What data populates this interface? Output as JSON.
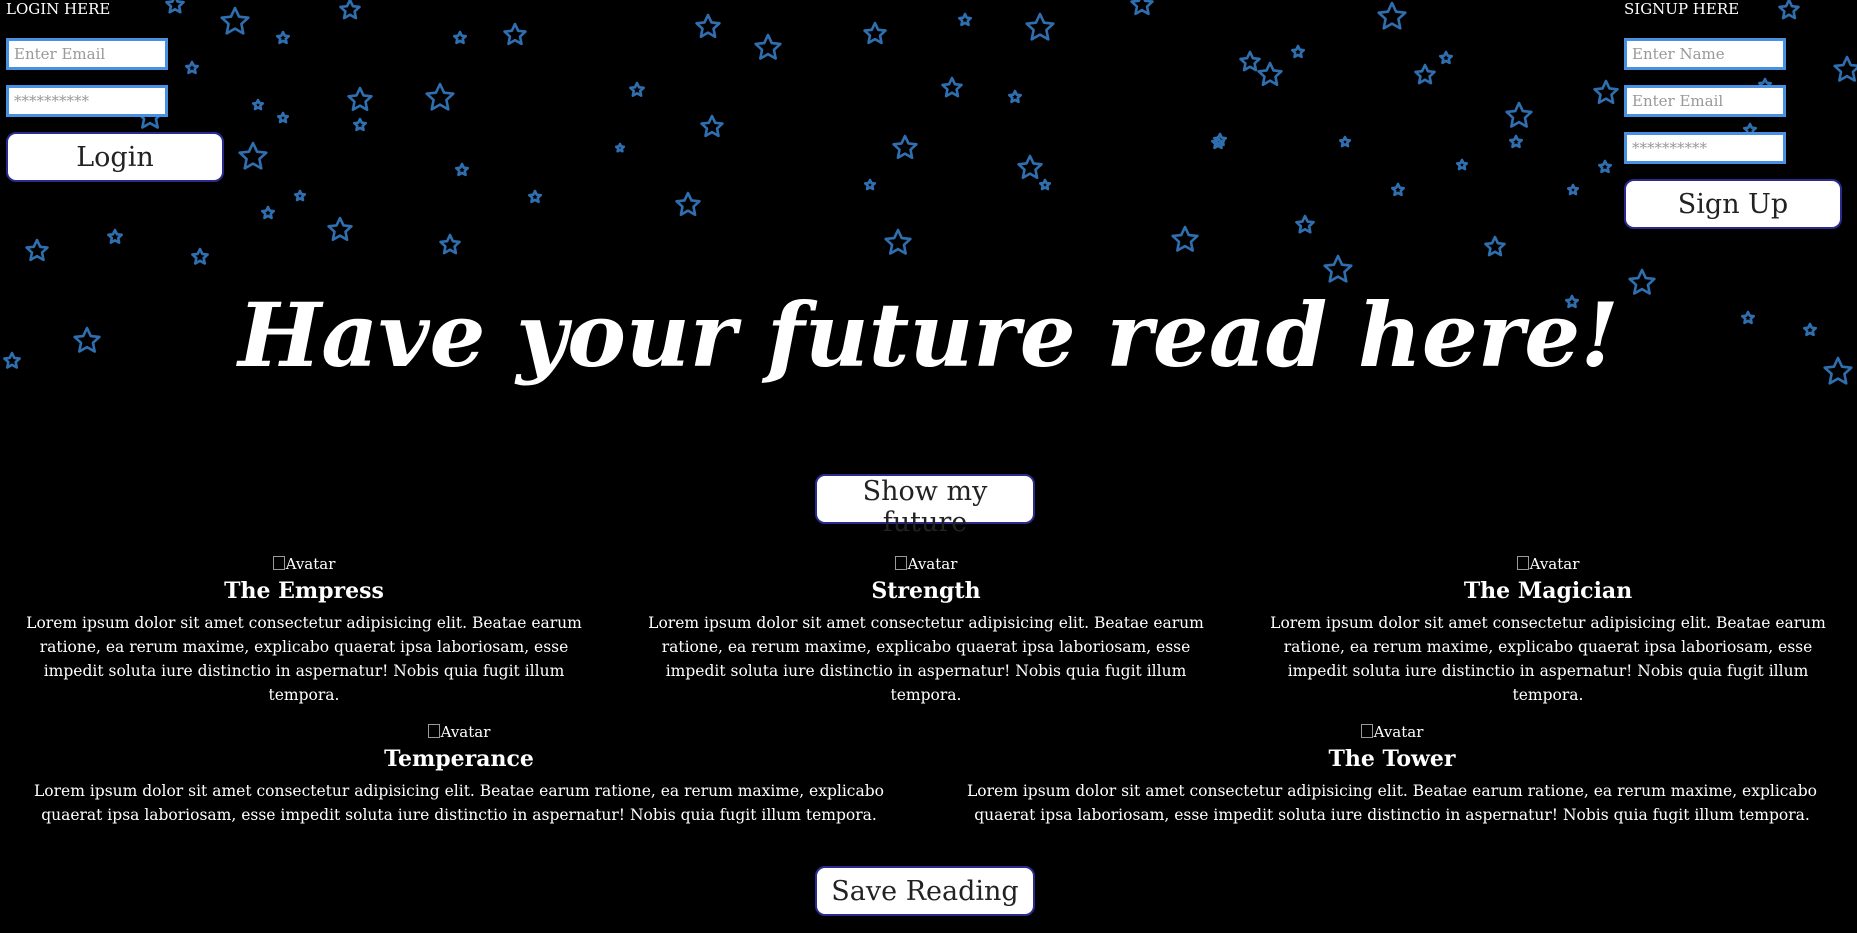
{
  "login": {
    "title": "LOGIN HERE",
    "email_placeholder": "Enter Email",
    "password_value": "**********",
    "button_label": "Login"
  },
  "signup": {
    "title": "SIGNUP HERE",
    "name_placeholder": "Enter Name",
    "email_placeholder": "Enter Email",
    "password_value": "**********",
    "button_label": "Sign Up"
  },
  "hero": {
    "title": "Have your future read here!",
    "show_button_label": "Show my future"
  },
  "cards": [
    {
      "avatar_alt": "Avatar",
      "title": "The Empress",
      "text": "Lorem ipsum dolor sit amet consectetur adipisicing elit. Beatae earum ratione, ea rerum maxime, explicabo quaerat ipsa laboriosam, esse impedit soluta iure distinctio in aspernatur! Nobis quia fugit illum tempora."
    },
    {
      "avatar_alt": "Avatar",
      "title": "Strength",
      "text": "Lorem ipsum dolor sit amet consectetur adipisicing elit. Beatae earum ratione, ea rerum maxime, explicabo quaerat ipsa laboriosam, esse impedit soluta iure distinctio in aspernatur! Nobis quia fugit illum tempora."
    },
    {
      "avatar_alt": "Avatar",
      "title": "The Magician",
      "text": "Lorem ipsum dolor sit amet consectetur adipisicing elit. Beatae earum ratione, ea rerum maxime, explicabo quaerat ipsa laboriosam, esse impedit soluta iure distinctio in aspernatur! Nobis quia fugit illum tempora."
    },
    {
      "avatar_alt": "Avatar",
      "title": "Temperance",
      "text": "Lorem ipsum dolor sit amet consectetur adipisicing elit. Beatae earum ratione, ea rerum maxime, explicabo quaerat ipsa laboriosam, esse impedit soluta iure distinctio in aspernatur! Nobis quia fugit illum tempora."
    },
    {
      "avatar_alt": "Avatar",
      "title": "The Tower",
      "text": "Lorem ipsum dolor sit amet consectetur adipisicing elit. Beatae earum ratione, ea rerum maxime, explicabo quaerat ipsa laboriosam, esse impedit soluta iure distinctio in aspernatur! Nobis quia fugit illum tempora."
    }
  ],
  "save_button_label": "Save Reading",
  "colors": {
    "background": "#000000",
    "star": "#2f6fb0",
    "moon": "#1e90ff",
    "field_border": "#4a90e2",
    "button_border": "#2b2b8f"
  }
}
